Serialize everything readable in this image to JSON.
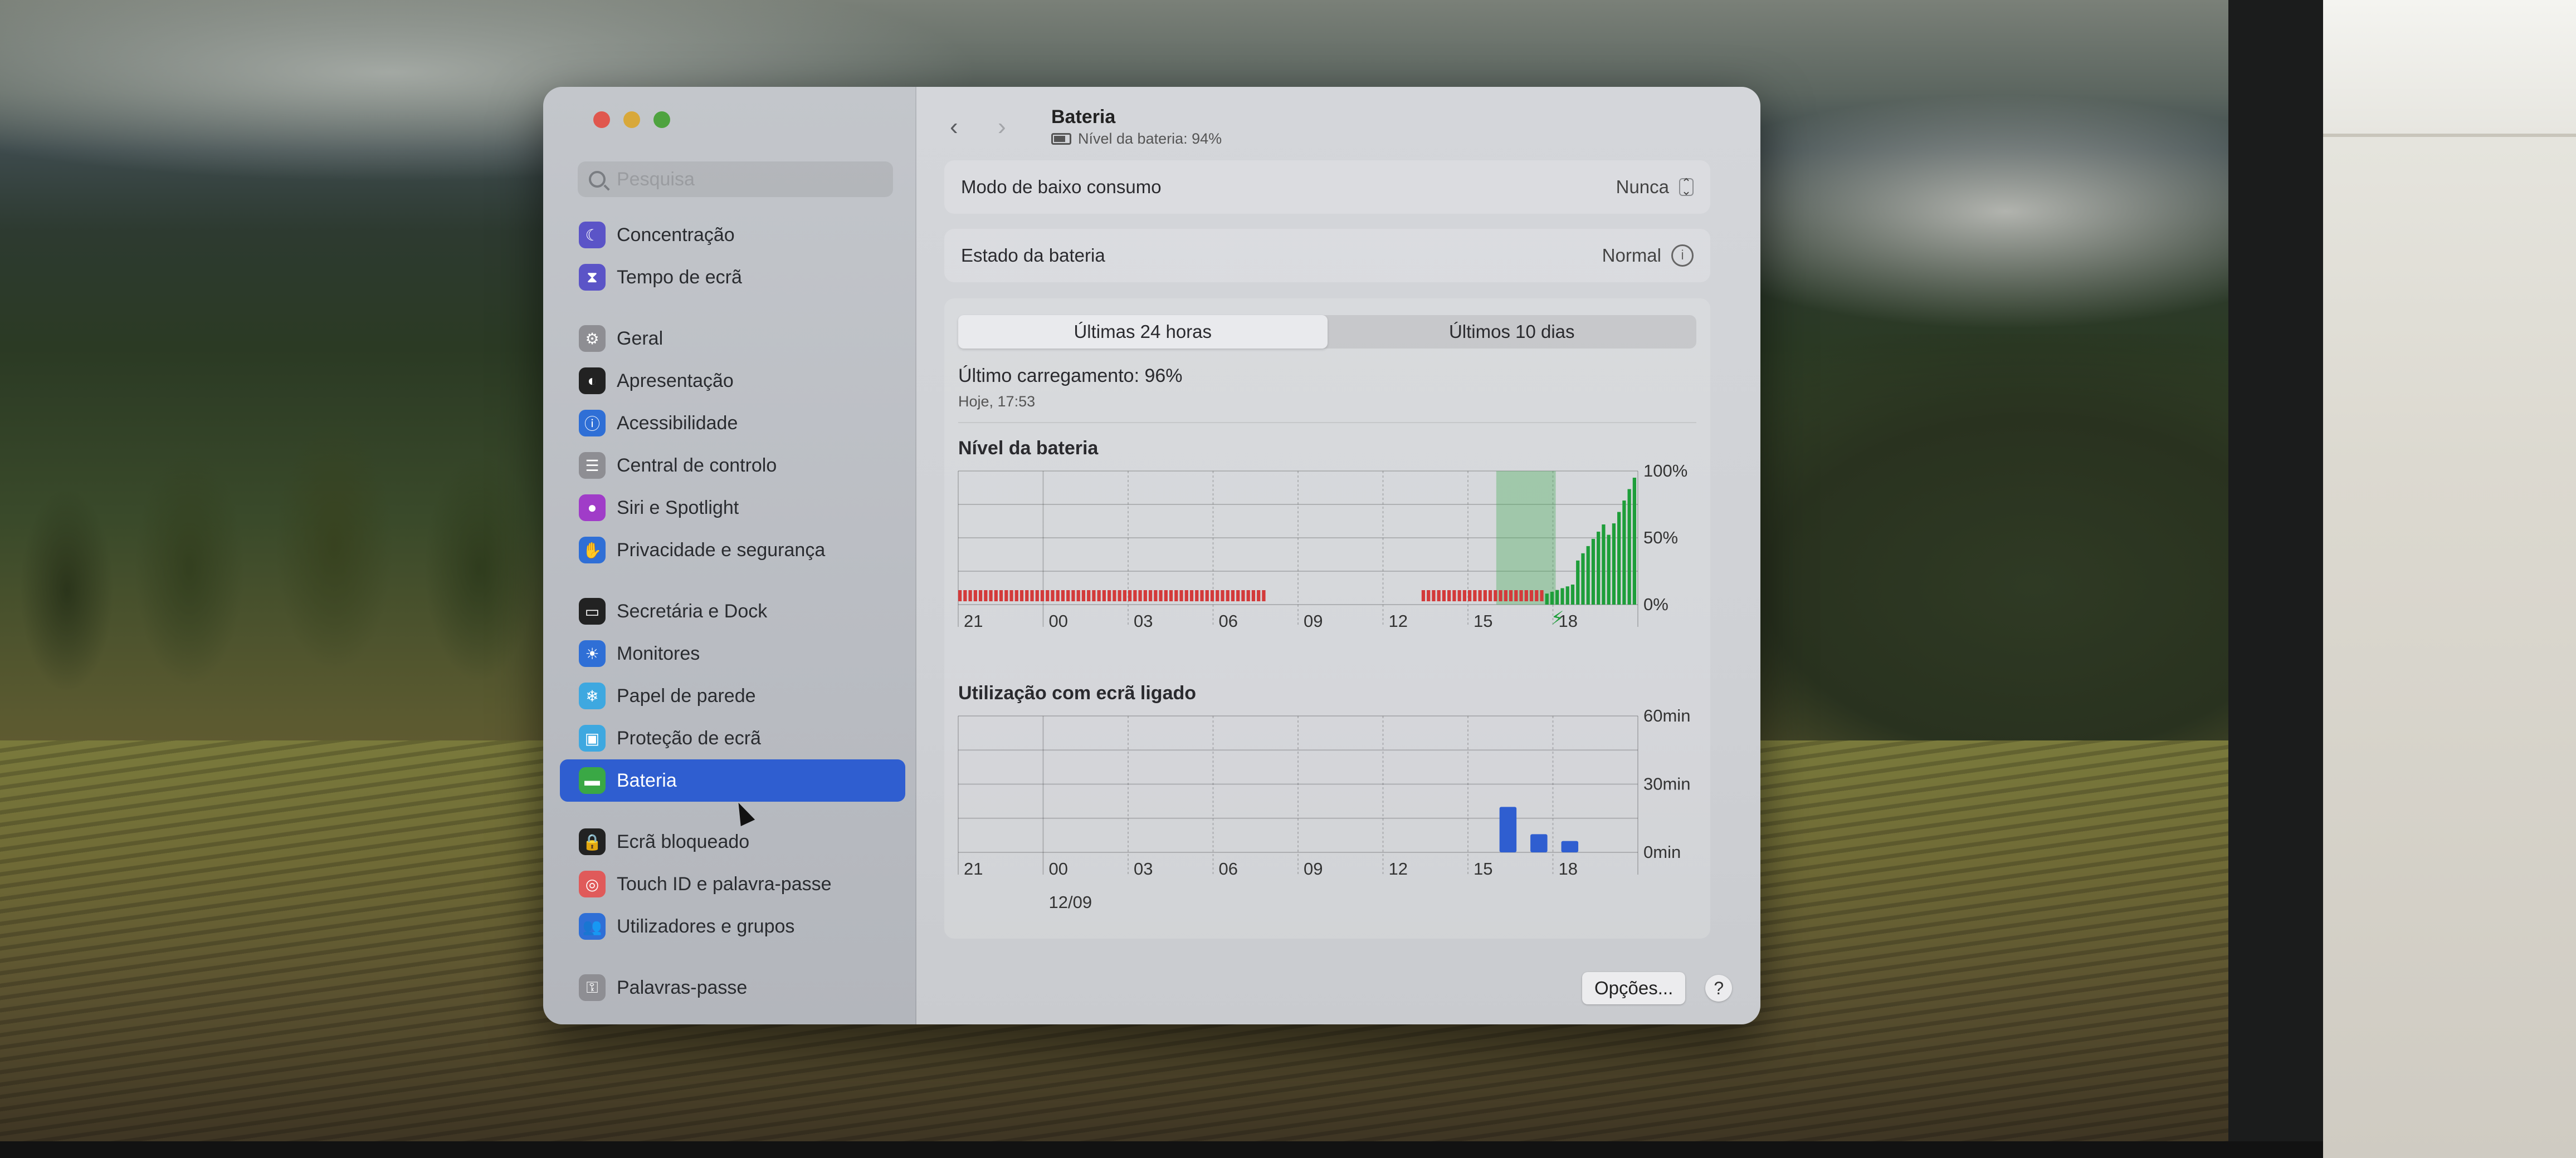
{
  "colors": {
    "accent": "#2f5ed0",
    "battery_green": "#1e9e3a",
    "battery_red": "#d33a3a",
    "usage_blue": "#2f5ed0"
  },
  "sidebar": {
    "search_placeholder": "Pesquisa",
    "items": [
      {
        "label": "Concentração",
        "icon": "moon-icon",
        "color": "#5b54c7"
      },
      {
        "label": "Tempo de ecrã",
        "icon": "hourglass-icon",
        "color": "#5b54c7"
      },
      {
        "label": "Geral",
        "icon": "gear-icon",
        "color": "#8e8e93"
      },
      {
        "label": "Apresentação",
        "icon": "appearance-icon",
        "color": "#222222"
      },
      {
        "label": "Acessibilidade",
        "icon": "accessibility-icon",
        "color": "#2f6fd6"
      },
      {
        "label": "Central de controlo",
        "icon": "control-center-icon",
        "color": "#8e8e93"
      },
      {
        "label": "Siri e Spotlight",
        "icon": "siri-icon",
        "color": "#a03cc8"
      },
      {
        "label": "Privacidade e segurança",
        "icon": "hand-icon",
        "color": "#2f6fd6"
      },
      {
        "label": "Secretária e Dock",
        "icon": "dock-icon",
        "color": "#222222"
      },
      {
        "label": "Monitores",
        "icon": "sun-icon",
        "color": "#2f6fd6"
      },
      {
        "label": "Papel de parede",
        "icon": "wallpaper-icon",
        "color": "#3ea8e0"
      },
      {
        "label": "Proteção de ecrã",
        "icon": "screensaver-icon",
        "color": "#3ea8e0"
      },
      {
        "label": "Bateria",
        "icon": "battery-icon",
        "color": "#3aa845"
      },
      {
        "label": "Ecrã bloqueado",
        "icon": "lock-icon",
        "color": "#222222"
      },
      {
        "label": "Touch ID e palavra-passe",
        "icon": "fingerprint-icon",
        "color": "#e05a5a"
      },
      {
        "label": "Utilizadores e grupos",
        "icon": "users-icon",
        "color": "#2f6fd6"
      },
      {
        "label": "Palavras-passe",
        "icon": "key-icon",
        "color": "#8e8e93"
      }
    ]
  },
  "header": {
    "title": "Bateria",
    "subtitle": "Nível da bateria: 94%"
  },
  "low_power": {
    "label": "Modo de baixo consumo",
    "value": "Nunca"
  },
  "battery_health": {
    "label": "Estado da bateria",
    "value": "Normal"
  },
  "tabs": [
    "Últimas 24 horas",
    "Últimos 10 dias"
  ],
  "last_charge": {
    "label": "Último carregamento: 96%",
    "date": "Hoje, 17:53"
  },
  "chart_data": [
    {
      "type": "bar",
      "title": "Nível da bateria",
      "x_ticks": [
        "21",
        "00",
        "03",
        "06",
        "09",
        "12",
        "15",
        "18"
      ],
      "y_ticks": [
        "100%",
        "50%",
        "0%"
      ],
      "ylim": [
        0,
        100
      ],
      "hours": [
        "21",
        "22",
        "23",
        "00",
        "01",
        "02",
        "03",
        "04",
        "05",
        "06",
        "07",
        "08",
        "09",
        "10",
        "11",
        "12",
        "13",
        "14",
        "15",
        "16",
        "17",
        "18"
      ],
      "values": [
        1,
        1,
        1,
        1,
        1,
        1,
        1,
        1,
        1,
        1,
        null,
        null,
        null,
        null,
        null,
        1,
        1,
        1,
        1,
        15,
        60,
        95
      ],
      "charging_hours": [
        "16",
        "17",
        "18"
      ],
      "note": "red = sem carga; green = a carregar"
    },
    {
      "type": "bar",
      "title": "Utilização com ecrã ligado",
      "x_ticks": [
        "21",
        "00",
        "03",
        "06",
        "09",
        "12",
        "15",
        "18"
      ],
      "x_subtick": "12/09",
      "y_ticks": [
        "60min",
        "30min",
        "0min"
      ],
      "ylim": [
        0,
        60
      ],
      "hours": [
        "16",
        "17",
        "18"
      ],
      "values": [
        20,
        8,
        5
      ]
    }
  ],
  "footer": {
    "options_label": "Opções...",
    "help_label": "?"
  }
}
